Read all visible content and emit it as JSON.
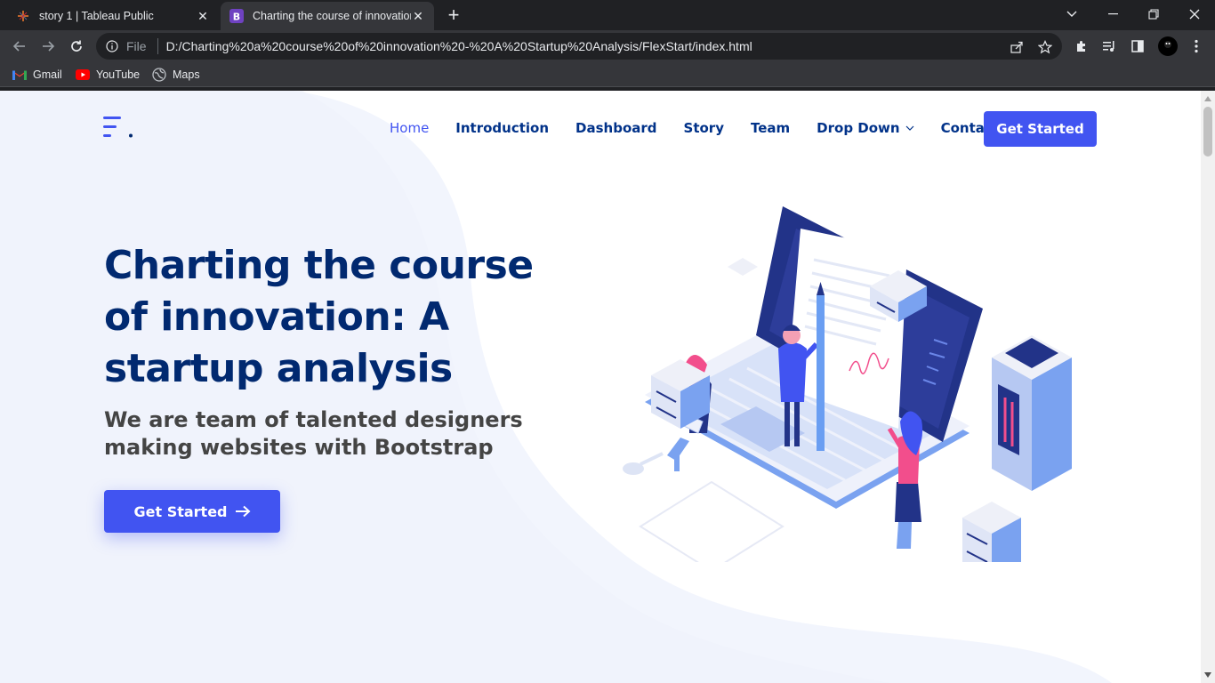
{
  "browser": {
    "tabs": [
      {
        "title": "story 1 | Tableau Public",
        "favicon": "tableau-icon"
      },
      {
        "title": "Charting the course of innovation",
        "favicon": "bootstrap-icon"
      }
    ],
    "address": {
      "scheme_label": "File",
      "url": "D:/Charting%20a%20course%20of%20innovation%20-%20A%20Startup%20Analysis/FlexStart/index.html"
    },
    "bookmarks": [
      {
        "label": "Gmail",
        "icon": "gmail-icon"
      },
      {
        "label": "YouTube",
        "icon": "youtube-icon"
      },
      {
        "label": "Maps",
        "icon": "maps-icon"
      }
    ]
  },
  "page": {
    "nav": {
      "items": [
        {
          "label": "Home"
        },
        {
          "label": "Introduction"
        },
        {
          "label": "Dashboard"
        },
        {
          "label": "Story"
        },
        {
          "label": "Team"
        },
        {
          "label": "Drop Down"
        },
        {
          "label": "Contact"
        }
      ],
      "cta": "Get Started"
    },
    "hero": {
      "title": "Charting the course of innovation: A startup analysis",
      "subtitle": "We are team of talented designers making websites with Bootstrap",
      "cta": "Get Started"
    }
  },
  "colors": {
    "primary": "#4154f1",
    "heading": "#012970",
    "nav": "#013289",
    "text": "#444444"
  }
}
